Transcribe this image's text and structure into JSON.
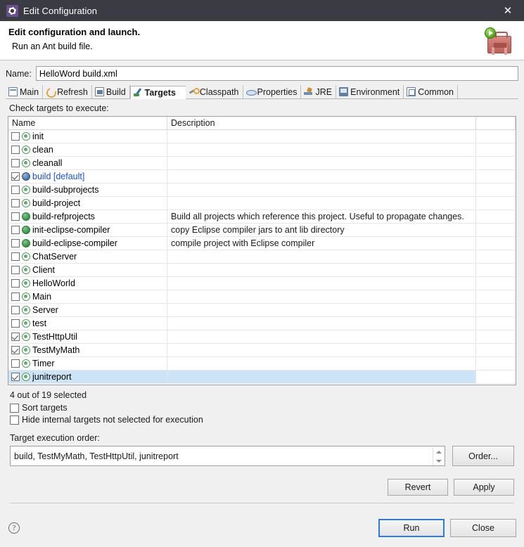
{
  "titlebar": {
    "title": "Edit Configuration",
    "icon": "gear-icon",
    "close_label": "✕"
  },
  "header": {
    "title": "Edit configuration and launch.",
    "subtitle": "Run an Ant build file.",
    "icon": "ant-toolbox-run-icon"
  },
  "name_row": {
    "label": "Name:",
    "value": "HelloWord build.xml",
    "placeholder": ""
  },
  "tabs": [
    {
      "label": "Main",
      "icon": "main-icon",
      "active": false
    },
    {
      "label": "Refresh",
      "icon": "refresh-icon",
      "active": false
    },
    {
      "label": "Build",
      "icon": "build-icon",
      "active": false
    },
    {
      "label": "Targets",
      "icon": "targets-icon",
      "active": true
    },
    {
      "label": "Classpath",
      "icon": "classpath-icon",
      "active": false
    },
    {
      "label": "Properties",
      "icon": "properties-icon",
      "active": false
    },
    {
      "label": "JRE",
      "icon": "jre-icon",
      "active": false
    },
    {
      "label": "Environment",
      "icon": "environment-icon",
      "active": false
    },
    {
      "label": "Common",
      "icon": "common-icon",
      "active": false
    }
  ],
  "targets_panel": {
    "check_label": "Check targets to execute:",
    "columns": [
      "Name",
      "Description"
    ],
    "rows": [
      {
        "name": "init",
        "description": "",
        "checked": false,
        "icon": "target-hollow-icon",
        "default": false
      },
      {
        "name": "clean",
        "description": "",
        "checked": false,
        "icon": "target-hollow-icon",
        "default": false
      },
      {
        "name": "cleanall",
        "description": "",
        "checked": false,
        "icon": "target-hollow-icon",
        "default": false
      },
      {
        "name": "build [default]",
        "description": "",
        "checked": true,
        "icon": "target-default-icon",
        "default": true
      },
      {
        "name": "build-subprojects",
        "description": "",
        "checked": false,
        "icon": "target-hollow-icon",
        "default": false
      },
      {
        "name": "build-project",
        "description": "",
        "checked": false,
        "icon": "target-hollow-icon",
        "default": false
      },
      {
        "name": "build-refprojects",
        "description": "Build all projects which reference this project. Useful to propagate changes.",
        "checked": false,
        "icon": "target-filled-icon",
        "default": false
      },
      {
        "name": "init-eclipse-compiler",
        "description": "copy Eclipse compiler jars to ant lib directory",
        "checked": false,
        "icon": "target-filled-icon",
        "default": false
      },
      {
        "name": "build-eclipse-compiler",
        "description": "compile project with Eclipse compiler",
        "checked": false,
        "icon": "target-filled-icon",
        "default": false
      },
      {
        "name": "ChatServer",
        "description": "",
        "checked": false,
        "icon": "target-hollow-icon",
        "default": false
      },
      {
        "name": "Client",
        "description": "",
        "checked": false,
        "icon": "target-hollow-icon",
        "default": false
      },
      {
        "name": "HelloWorld",
        "description": "",
        "checked": false,
        "icon": "target-hollow-icon",
        "default": false
      },
      {
        "name": "Main",
        "description": "",
        "checked": false,
        "icon": "target-hollow-icon",
        "default": false
      },
      {
        "name": "Server",
        "description": "",
        "checked": false,
        "icon": "target-hollow-icon",
        "default": false
      },
      {
        "name": "test",
        "description": "",
        "checked": false,
        "icon": "target-hollow-icon",
        "default": false
      },
      {
        "name": "TestHttpUtil",
        "description": "",
        "checked": true,
        "icon": "target-hollow-icon",
        "default": false
      },
      {
        "name": "TestMyMath",
        "description": "",
        "checked": true,
        "icon": "target-hollow-icon",
        "default": false
      },
      {
        "name": "Timer",
        "description": "",
        "checked": false,
        "icon": "target-hollow-icon",
        "default": false
      },
      {
        "name": "junitreport",
        "description": "",
        "checked": true,
        "icon": "target-hollow-icon",
        "default": false,
        "selected": true
      }
    ],
    "selection_count": "4 out of 19 selected",
    "sort_targets": {
      "label": "Sort targets",
      "checked": false
    },
    "hide_internal": {
      "label": "Hide internal targets not selected for execution",
      "checked": false
    },
    "order_label": "Target execution order:",
    "order_value": "build, TestMyMath, TestHttpUtil, junitreport",
    "order_button": "Order..."
  },
  "apply_bar": {
    "revert": "Revert",
    "apply": "Apply"
  },
  "footer": {
    "help": "?",
    "run": "Run",
    "close": "Close"
  },
  "colors": {
    "titlebar_bg": "#3b3b43",
    "dialog_bg": "#f0f0f0",
    "selection_blue": "#cce4f7",
    "default_link": "#1a4fd0",
    "focus_border": "#2b7cd3",
    "target_green": "#2e8b42"
  }
}
